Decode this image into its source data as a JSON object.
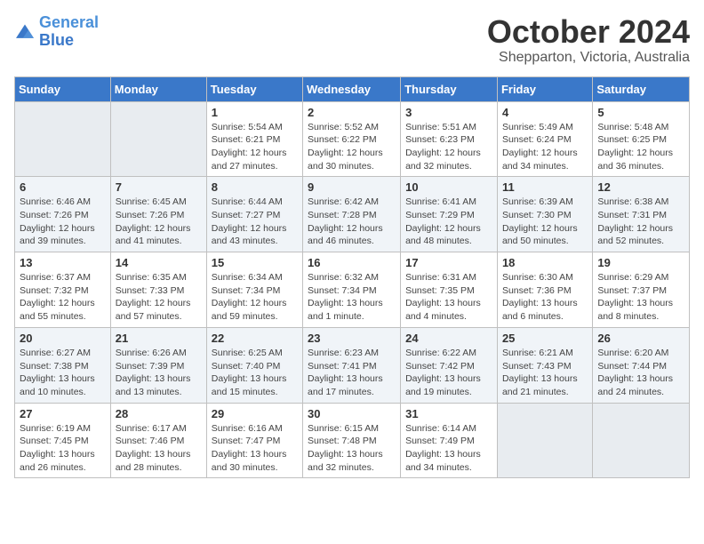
{
  "logo": {
    "line1": "General",
    "line2": "Blue"
  },
  "title": "October 2024",
  "location": "Shepparton, Victoria, Australia",
  "weekdays": [
    "Sunday",
    "Monday",
    "Tuesday",
    "Wednesday",
    "Thursday",
    "Friday",
    "Saturday"
  ],
  "weeks": [
    [
      {
        "day": "",
        "info": ""
      },
      {
        "day": "",
        "info": ""
      },
      {
        "day": "1",
        "info": "Sunrise: 5:54 AM\nSunset: 6:21 PM\nDaylight: 12 hours\nand 27 minutes."
      },
      {
        "day": "2",
        "info": "Sunrise: 5:52 AM\nSunset: 6:22 PM\nDaylight: 12 hours\nand 30 minutes."
      },
      {
        "day": "3",
        "info": "Sunrise: 5:51 AM\nSunset: 6:23 PM\nDaylight: 12 hours\nand 32 minutes."
      },
      {
        "day": "4",
        "info": "Sunrise: 5:49 AM\nSunset: 6:24 PM\nDaylight: 12 hours\nand 34 minutes."
      },
      {
        "day": "5",
        "info": "Sunrise: 5:48 AM\nSunset: 6:25 PM\nDaylight: 12 hours\nand 36 minutes."
      }
    ],
    [
      {
        "day": "6",
        "info": "Sunrise: 6:46 AM\nSunset: 7:26 PM\nDaylight: 12 hours\nand 39 minutes."
      },
      {
        "day": "7",
        "info": "Sunrise: 6:45 AM\nSunset: 7:26 PM\nDaylight: 12 hours\nand 41 minutes."
      },
      {
        "day": "8",
        "info": "Sunrise: 6:44 AM\nSunset: 7:27 PM\nDaylight: 12 hours\nand 43 minutes."
      },
      {
        "day": "9",
        "info": "Sunrise: 6:42 AM\nSunset: 7:28 PM\nDaylight: 12 hours\nand 46 minutes."
      },
      {
        "day": "10",
        "info": "Sunrise: 6:41 AM\nSunset: 7:29 PM\nDaylight: 12 hours\nand 48 minutes."
      },
      {
        "day": "11",
        "info": "Sunrise: 6:39 AM\nSunset: 7:30 PM\nDaylight: 12 hours\nand 50 minutes."
      },
      {
        "day": "12",
        "info": "Sunrise: 6:38 AM\nSunset: 7:31 PM\nDaylight: 12 hours\nand 52 minutes."
      }
    ],
    [
      {
        "day": "13",
        "info": "Sunrise: 6:37 AM\nSunset: 7:32 PM\nDaylight: 12 hours\nand 55 minutes."
      },
      {
        "day": "14",
        "info": "Sunrise: 6:35 AM\nSunset: 7:33 PM\nDaylight: 12 hours\nand 57 minutes."
      },
      {
        "day": "15",
        "info": "Sunrise: 6:34 AM\nSunset: 7:34 PM\nDaylight: 12 hours\nand 59 minutes."
      },
      {
        "day": "16",
        "info": "Sunrise: 6:32 AM\nSunset: 7:34 PM\nDaylight: 13 hours\nand 1 minute."
      },
      {
        "day": "17",
        "info": "Sunrise: 6:31 AM\nSunset: 7:35 PM\nDaylight: 13 hours\nand 4 minutes."
      },
      {
        "day": "18",
        "info": "Sunrise: 6:30 AM\nSunset: 7:36 PM\nDaylight: 13 hours\nand 6 minutes."
      },
      {
        "day": "19",
        "info": "Sunrise: 6:29 AM\nSunset: 7:37 PM\nDaylight: 13 hours\nand 8 minutes."
      }
    ],
    [
      {
        "day": "20",
        "info": "Sunrise: 6:27 AM\nSunset: 7:38 PM\nDaylight: 13 hours\nand 10 minutes."
      },
      {
        "day": "21",
        "info": "Sunrise: 6:26 AM\nSunset: 7:39 PM\nDaylight: 13 hours\nand 13 minutes."
      },
      {
        "day": "22",
        "info": "Sunrise: 6:25 AM\nSunset: 7:40 PM\nDaylight: 13 hours\nand 15 minutes."
      },
      {
        "day": "23",
        "info": "Sunrise: 6:23 AM\nSunset: 7:41 PM\nDaylight: 13 hours\nand 17 minutes."
      },
      {
        "day": "24",
        "info": "Sunrise: 6:22 AM\nSunset: 7:42 PM\nDaylight: 13 hours\nand 19 minutes."
      },
      {
        "day": "25",
        "info": "Sunrise: 6:21 AM\nSunset: 7:43 PM\nDaylight: 13 hours\nand 21 minutes."
      },
      {
        "day": "26",
        "info": "Sunrise: 6:20 AM\nSunset: 7:44 PM\nDaylight: 13 hours\nand 24 minutes."
      }
    ],
    [
      {
        "day": "27",
        "info": "Sunrise: 6:19 AM\nSunset: 7:45 PM\nDaylight: 13 hours\nand 26 minutes."
      },
      {
        "day": "28",
        "info": "Sunrise: 6:17 AM\nSunset: 7:46 PM\nDaylight: 13 hours\nand 28 minutes."
      },
      {
        "day": "29",
        "info": "Sunrise: 6:16 AM\nSunset: 7:47 PM\nDaylight: 13 hours\nand 30 minutes."
      },
      {
        "day": "30",
        "info": "Sunrise: 6:15 AM\nSunset: 7:48 PM\nDaylight: 13 hours\nand 32 minutes."
      },
      {
        "day": "31",
        "info": "Sunrise: 6:14 AM\nSunset: 7:49 PM\nDaylight: 13 hours\nand 34 minutes."
      },
      {
        "day": "",
        "info": ""
      },
      {
        "day": "",
        "info": ""
      }
    ]
  ]
}
